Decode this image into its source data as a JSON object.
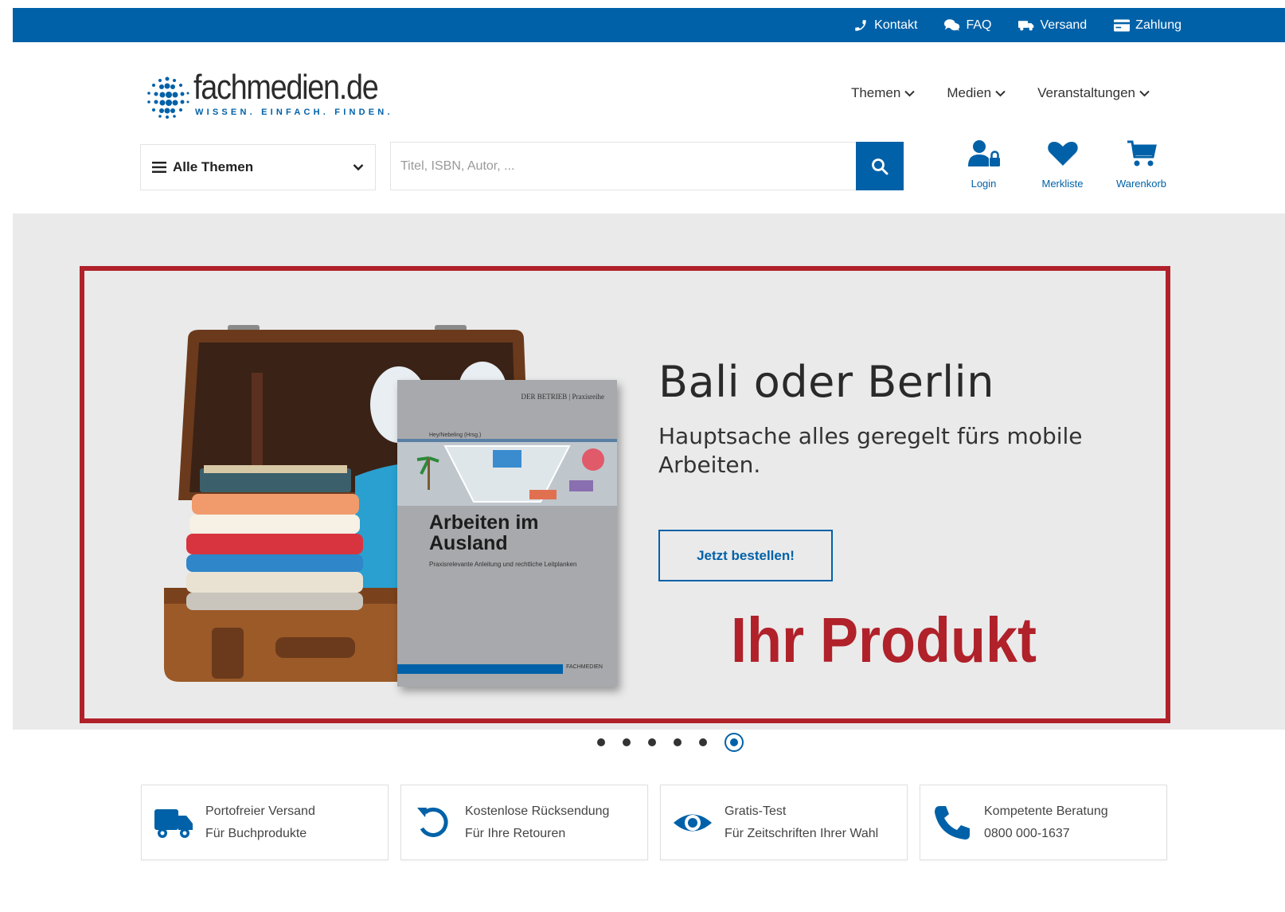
{
  "topbar": {
    "links": [
      {
        "label": "Kontakt",
        "icon": "phone-icon"
      },
      {
        "label": "FAQ",
        "icon": "chat-icon"
      },
      {
        "label": "Versand",
        "icon": "truck-icon"
      },
      {
        "label": "Zahlung",
        "icon": "credit-card-icon"
      }
    ]
  },
  "logo": {
    "word": "fachmedien.de",
    "tagline": "WISSEN. EINFACH. FINDEN."
  },
  "nav": {
    "items": [
      "Themen",
      "Medien",
      "Veranstaltungen"
    ]
  },
  "search": {
    "category_label": "Alle Themen",
    "placeholder": "Titel, ISBN, Autor, ..."
  },
  "actions": {
    "login": "Login",
    "wishlist": "Merkliste",
    "cart": "Warenkorb"
  },
  "hero": {
    "title": "Bali oder Berlin",
    "subtitle": "Hauptsache alles geregelt fürs mobile Arbeiten.",
    "cta": "Jetzt bestellen!",
    "overlay": "Ihr Produkt",
    "book": {
      "series": "DER BETRIEB | Praxisreihe",
      "editor": "Hey/Nebeling (Hrsg.)",
      "title": "Arbeiten im Ausland",
      "subtitle": "Praxisrelevante Anleitung und rechtliche Leitplanken",
      "publisher": "FACHMEDIEN"
    }
  },
  "carousel": {
    "slide_count": 6,
    "active_index": 5
  },
  "features": [
    {
      "title": "Portofreier Versand",
      "sub": "Für Buchprodukte",
      "icon": "truck-icon"
    },
    {
      "title": "Kostenlose Rücksendung",
      "sub": "Für Ihre Retouren",
      "icon": "return-icon"
    },
    {
      "title": "Gratis-Test",
      "sub": "Für Zeitschriften Ihrer Wahl",
      "icon": "eye-icon"
    },
    {
      "title": "Kompetente Beratung",
      "sub": "0800 000-1637",
      "icon": "phone-icon"
    }
  ],
  "colors": {
    "brand_blue": "#0061a8",
    "highlight_red": "#b0212a",
    "hero_bg": "#eaeaea"
  }
}
